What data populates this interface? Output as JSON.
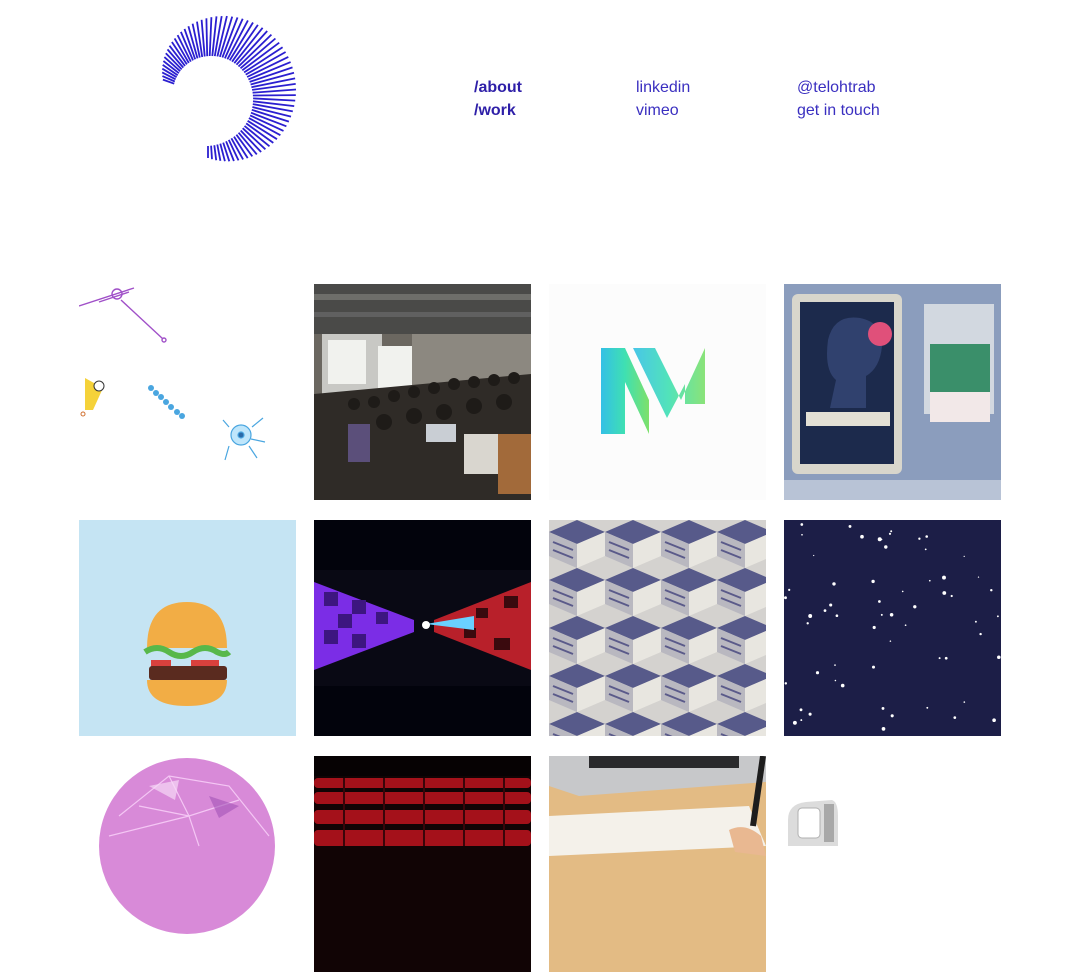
{
  "nav": {
    "about": "/about",
    "work": "/work",
    "linkedin": "linkedin",
    "vimeo": "vimeo",
    "handle": "@telohtrab",
    "contact": "get in touch"
  },
  "colors": {
    "accent": "#2e1fa8",
    "link": "#3a2fc0"
  },
  "projects": [
    {
      "thumbnail": "sketch-dots-illustration"
    },
    {
      "thumbnail": "conference-audience-photo"
    },
    {
      "thumbnail": "m-logo-gradient"
    },
    {
      "thumbnail": "metro-poster-photo"
    },
    {
      "thumbnail": "burger-illustration"
    },
    {
      "thumbnail": "checkered-tunnel-render"
    },
    {
      "thumbnail": "isometric-cube-pattern"
    },
    {
      "thumbnail": "starfield"
    },
    {
      "thumbnail": "pink-crystal-sphere"
    },
    {
      "thumbnail": "red-theater-seats-photo"
    },
    {
      "thumbnail": "laptop-desk-photo"
    },
    {
      "thumbnail": "device-photo"
    }
  ]
}
